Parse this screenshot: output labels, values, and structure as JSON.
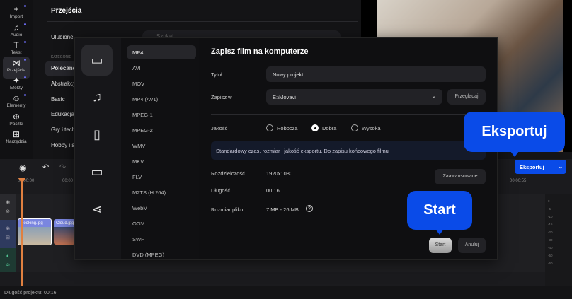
{
  "rail": [
    {
      "label": "Import",
      "icon": "+"
    },
    {
      "label": "Audio",
      "icon": "♫"
    },
    {
      "label": "Tekst",
      "icon": "T"
    },
    {
      "label": "Przejścia",
      "icon": "⋈"
    },
    {
      "label": "Efekty",
      "icon": "✦"
    },
    {
      "label": "Elementy",
      "icon": "☺"
    },
    {
      "label": "Paczki",
      "icon": "⊕"
    },
    {
      "label": "Narzędzia",
      "icon": "⊞"
    }
  ],
  "transitions": {
    "title": "Przejścia",
    "favorites": "Ulubione",
    "categories_heading": "KATEGORIE",
    "search_placeholder": "Szukaj",
    "categories": [
      "Polecane",
      "Abstrakcyjne",
      "Basic",
      "Edukacja",
      "Gry i technologia",
      "Hobby i sport"
    ]
  },
  "dialog": {
    "title": "Zapisz film na komputerze",
    "formats": [
      "MP4",
      "AVI",
      "MOV",
      "MP4 (AV1)",
      "MPEG-1",
      "MPEG-2",
      "WMV",
      "MKV",
      "FLV",
      "M2TS (H.264)",
      "WebM",
      "OGV",
      "SWF",
      "DVD (MPEG)"
    ],
    "title_label": "Tytuł",
    "title_value": "Nowy projekt",
    "save_label": "Zapisz w",
    "save_value": "E:\\Movavi",
    "browse": "Przeglądaj",
    "quality_label": "Jakość",
    "quality_options": [
      "Robocza",
      "Dobra",
      "Wysoka"
    ],
    "quality_selected": "Dobra",
    "quality_info": "Standardowy czas, rozmiar i jakość eksportu. Do zapisu końcowego filmu",
    "resolution_label": "Rozdzielczość",
    "resolution": "1920x1080",
    "duration_label": "Długość",
    "duration": "00:16",
    "size_label": "Rozmiar pliku",
    "size": "7 MB - 26 MB",
    "advanced": "Zaawansowane",
    "start": "Start",
    "cancel": "Anuluj"
  },
  "timeline": {
    "export": "Eksportuj",
    "ruler": [
      "00:00:00",
      "00:00",
      "00:00:55"
    ],
    "clips": [
      "Cooking.jpg",
      "Cloud.jpg"
    ],
    "project_length": "Długość projektu: 00:16",
    "meter": [
      "0",
      "-5",
      "-10",
      "-15",
      "-20",
      "-30",
      "-40",
      "-50",
      "-60"
    ]
  },
  "callouts": {
    "export": "Eksportuj",
    "start": "Start"
  },
  "colors": {
    "accent": "#0a4be8"
  }
}
